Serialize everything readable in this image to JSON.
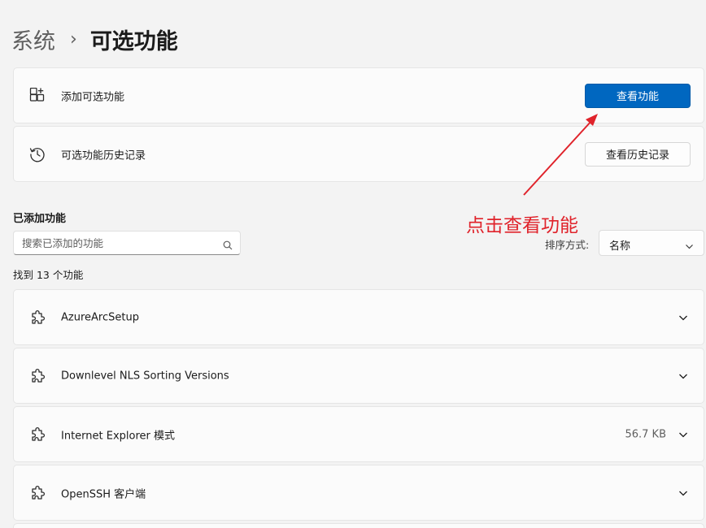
{
  "breadcrumb": {
    "parent": "系统",
    "separator": "›",
    "current": "可选功能"
  },
  "add_feature_card": {
    "label": "添加可选功能",
    "button_label": "查看功能",
    "icon": "add-apps-icon"
  },
  "history_card": {
    "label": "可选功能历史记录",
    "button_label": "查看历史记录",
    "icon": "history-icon"
  },
  "installed_section": {
    "title": "已添加功能",
    "search_placeholder": "搜索已添加的功能",
    "sort_label": "排序方式:",
    "sort_value": "名称",
    "count_text": "找到 13 个功能"
  },
  "features": [
    {
      "name": "AzureArcSetup",
      "size": ""
    },
    {
      "name": "Downlevel NLS Sorting Versions",
      "size": ""
    },
    {
      "name": "Internet Explorer 模式",
      "size": "56.7 KB"
    },
    {
      "name": "OpenSSH 客户端",
      "size": ""
    }
  ],
  "annotation": {
    "text": "点击查看功能",
    "color": "#e0232b"
  },
  "colors": {
    "accent": "#0067c0",
    "background": "#f3f3f3",
    "card": "#fbfbfb"
  }
}
